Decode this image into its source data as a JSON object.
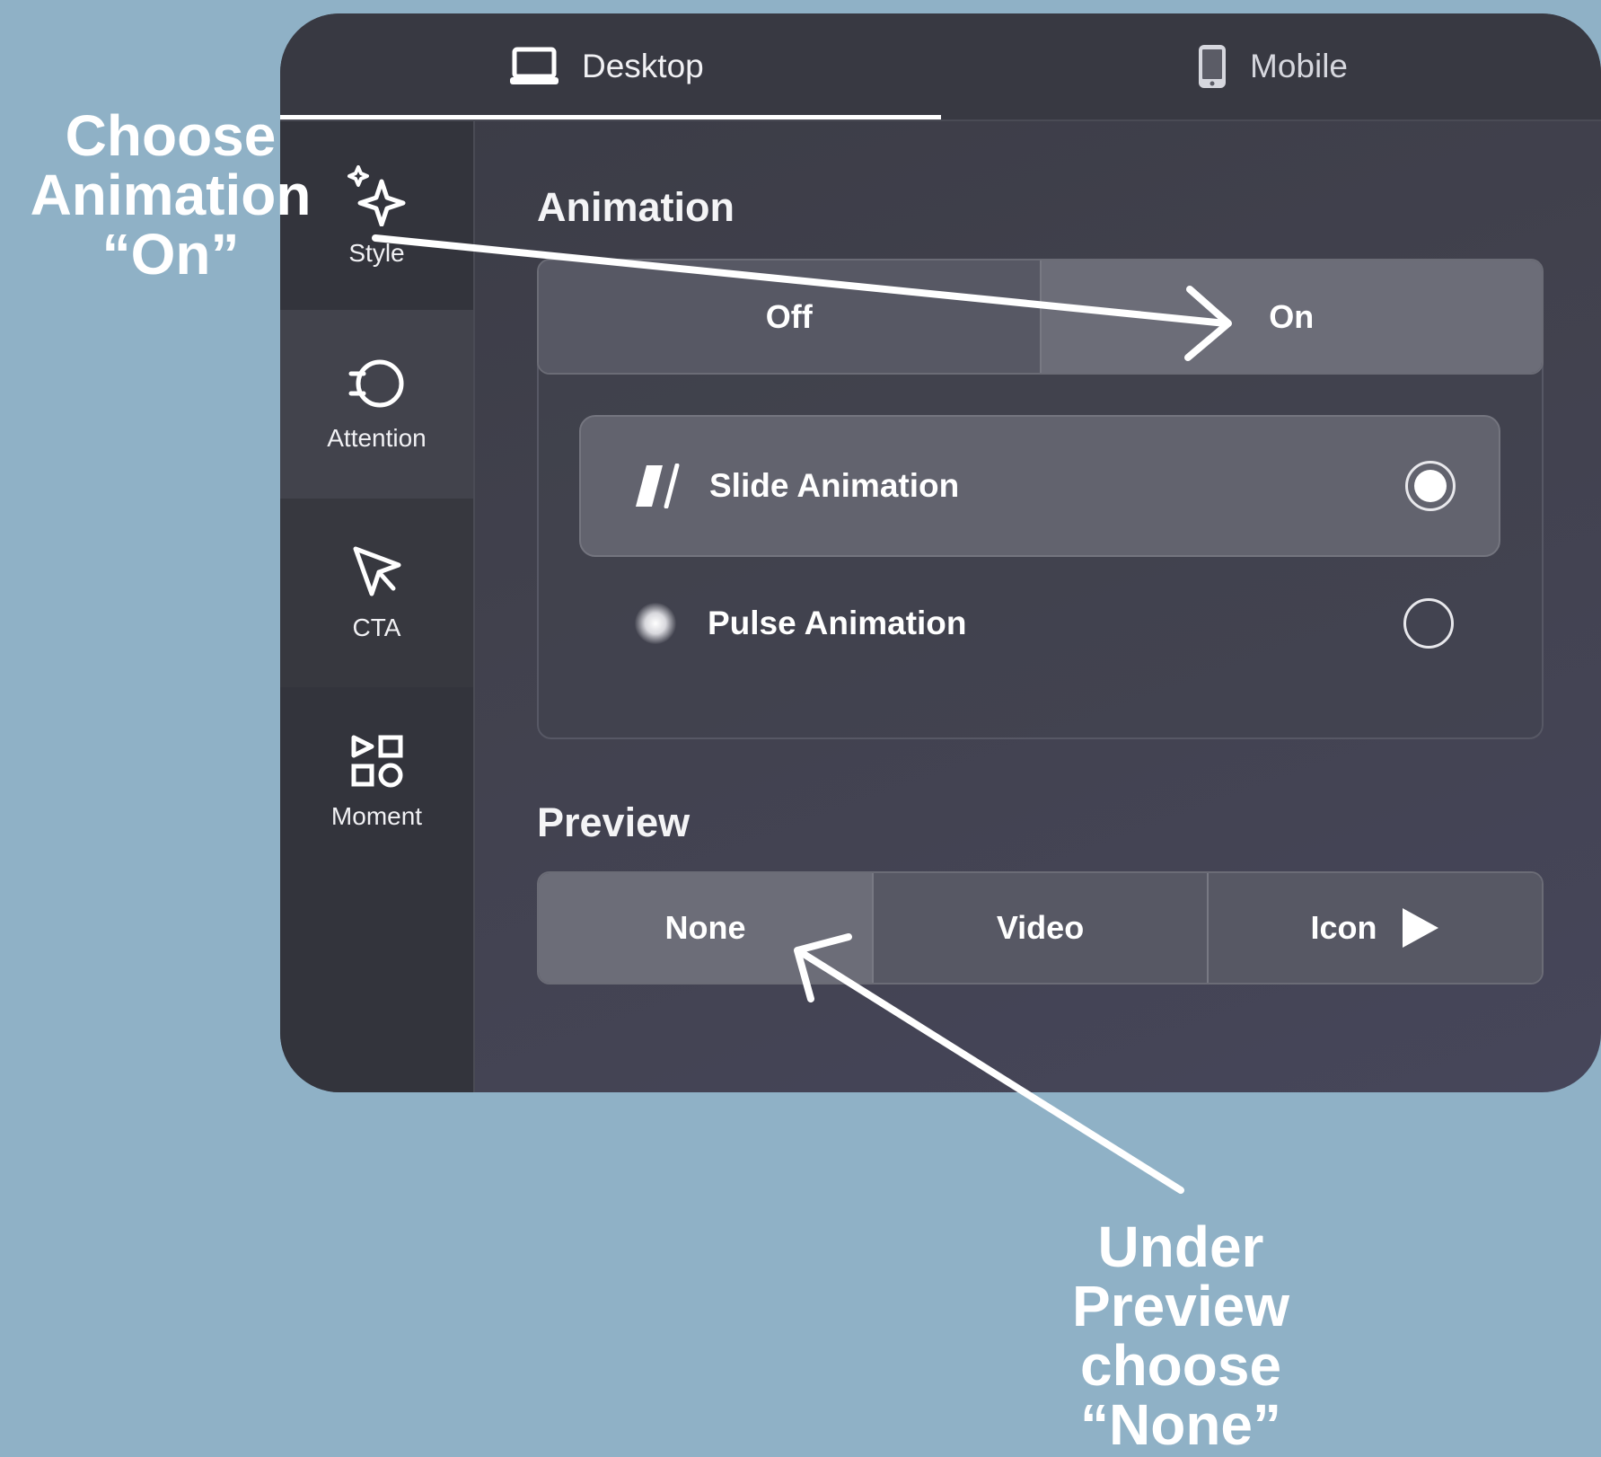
{
  "tabs": {
    "desktop": {
      "label": "Desktop",
      "icon": "laptop-icon"
    },
    "mobile": {
      "label": "Mobile",
      "icon": "phone-icon"
    }
  },
  "sidebar": {
    "items": [
      {
        "label": "Style",
        "icon": "sparkle-icon"
      },
      {
        "label": "Attention",
        "icon": "attention-icon"
      },
      {
        "label": "CTA",
        "icon": "cursor-icon"
      },
      {
        "label": "Moment",
        "icon": "shapes-icon"
      }
    ]
  },
  "animation": {
    "title": "Animation",
    "off_label": "Off",
    "on_label": "On",
    "selected": "On",
    "options": [
      {
        "label": "Slide Animation",
        "icon": "slide-icon",
        "selected": true
      },
      {
        "label": "Pulse Animation",
        "icon": "pulse-icon",
        "selected": false
      }
    ]
  },
  "preview": {
    "title": "Preview",
    "options": [
      "None",
      "Video",
      "Icon"
    ],
    "selected": "None"
  },
  "annotations": {
    "choose": [
      "Choose",
      "Animation",
      "“On”"
    ],
    "under": [
      "Under",
      "Preview",
      "choose",
      "“None”"
    ]
  },
  "colors": {
    "background": "#8fb1c6",
    "panel": "#3f404b",
    "selected_segment": "#6c6d78",
    "annotation": "#ffffff"
  }
}
